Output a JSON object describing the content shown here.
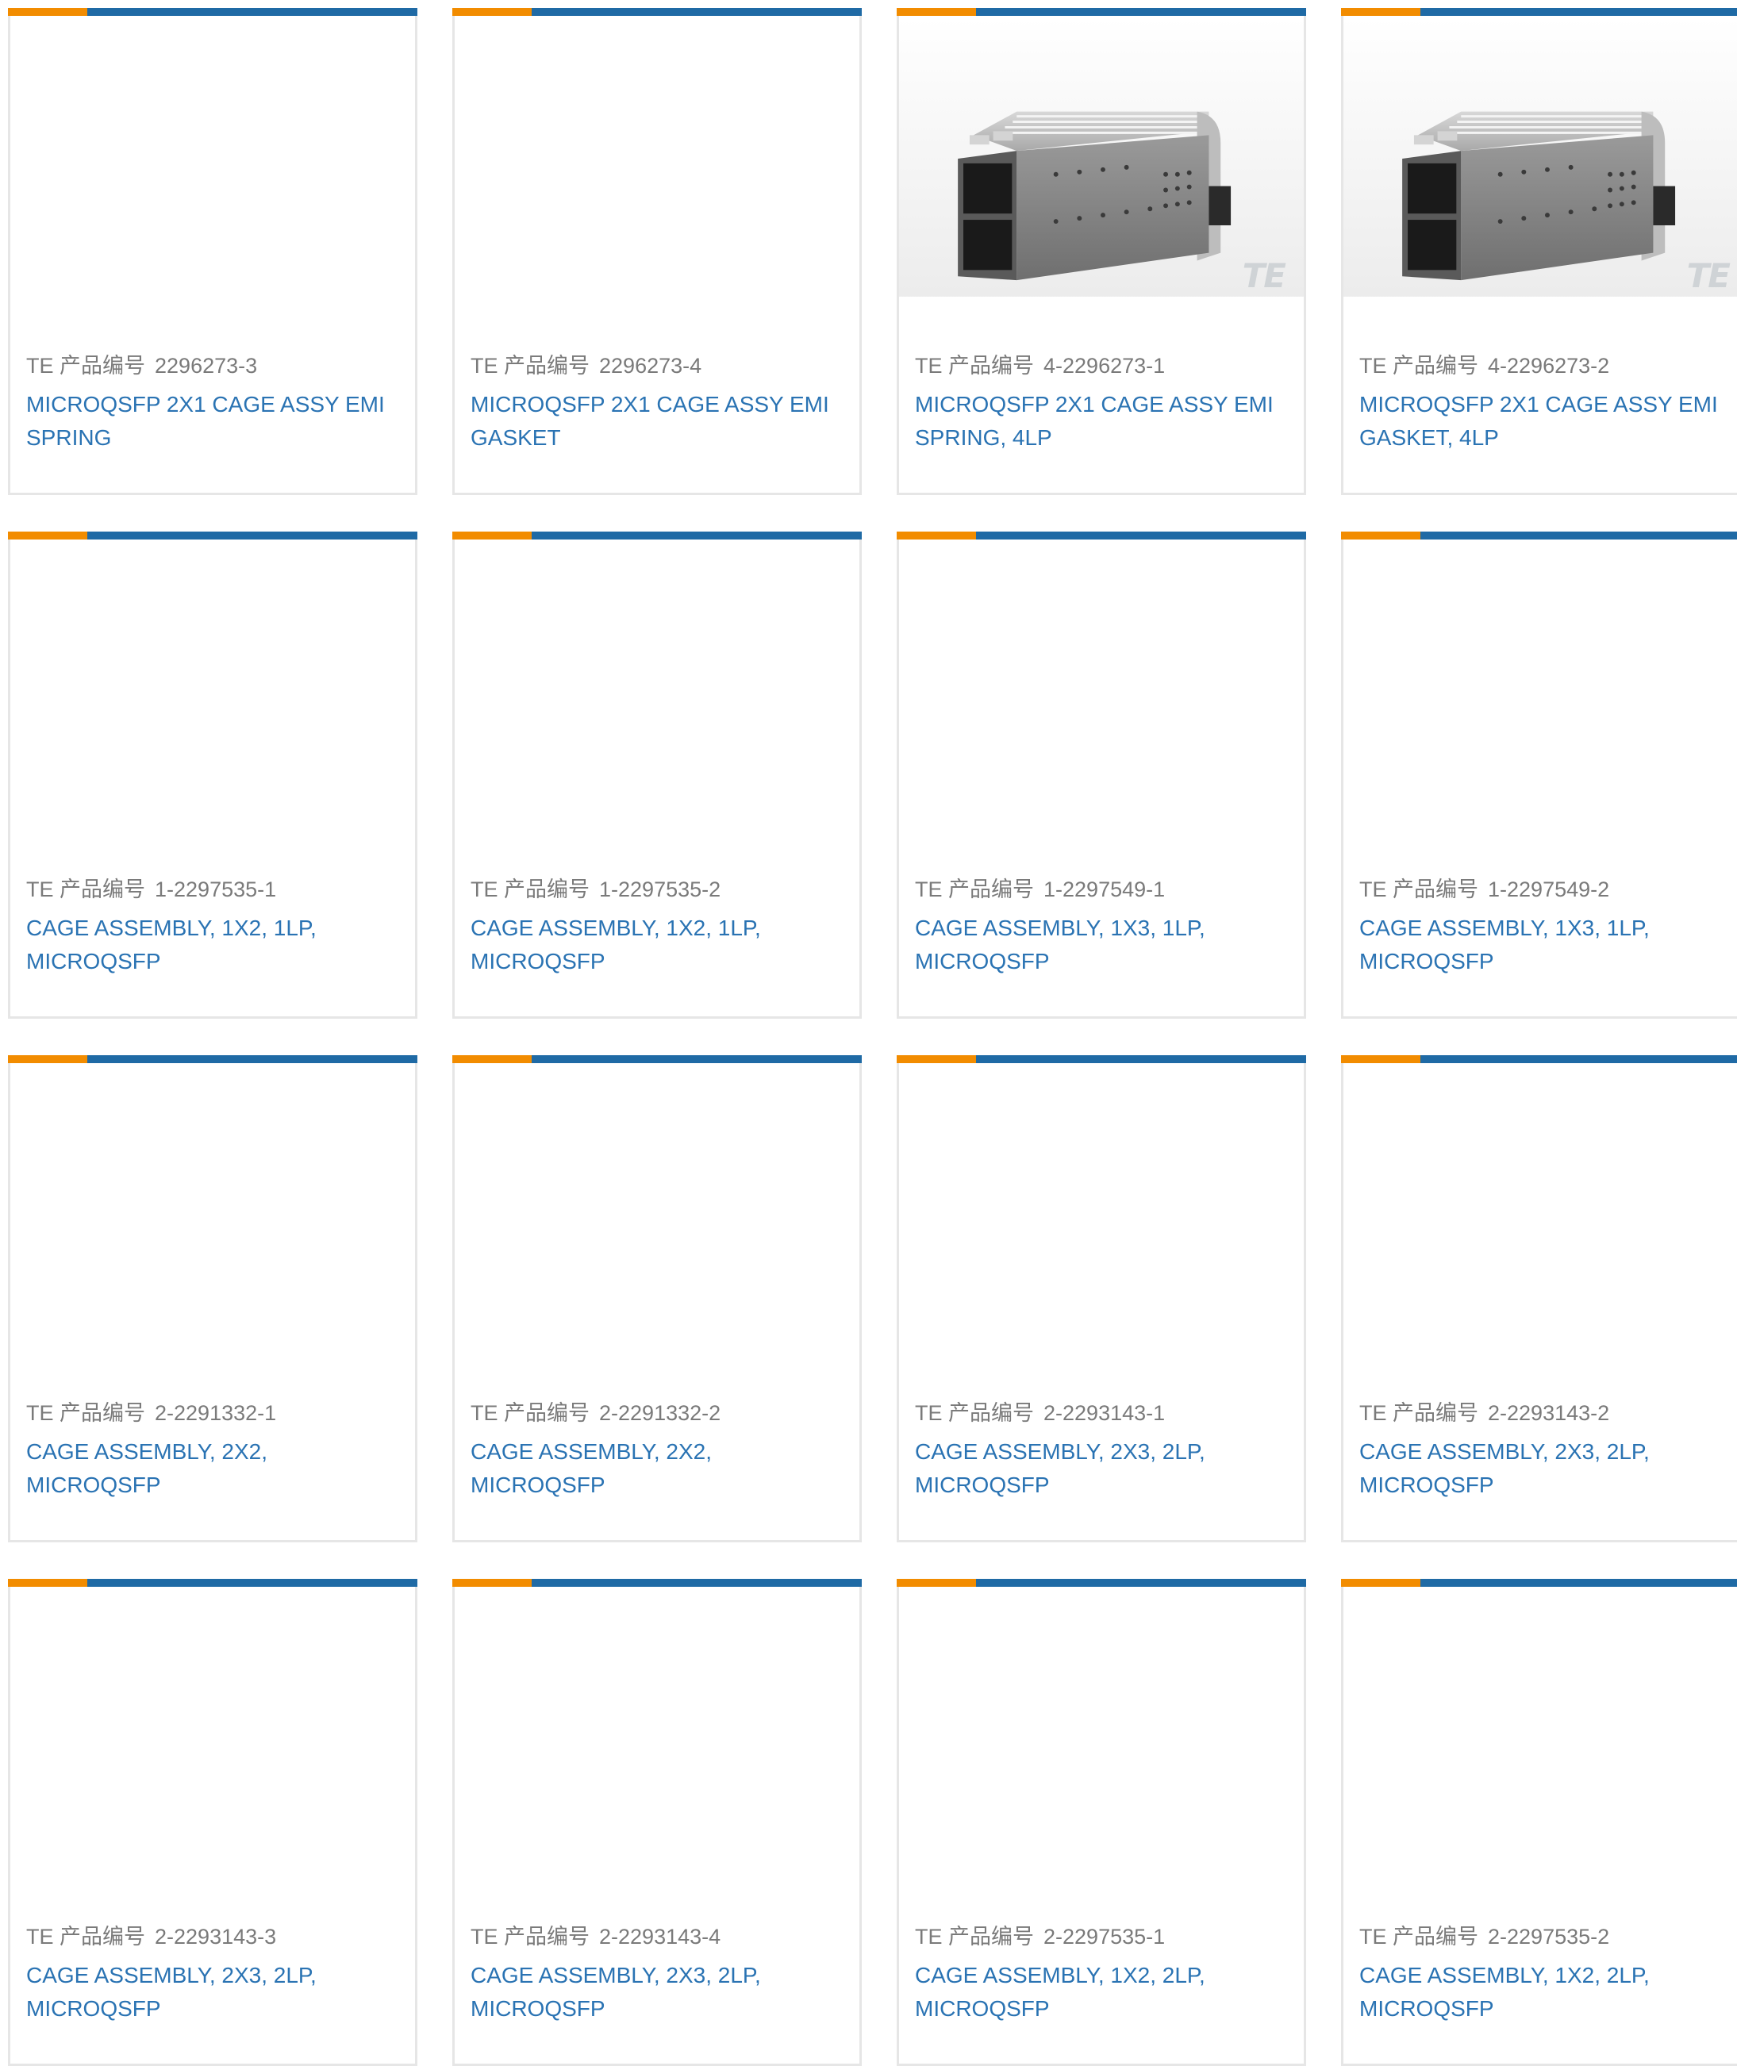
{
  "colors": {
    "accent_orange": "#f28c00",
    "accent_blue": "#1f6aa5",
    "link_blue": "#2a73b3",
    "label_gray": "#7a7a7a",
    "border_gray": "#e6e6e6"
  },
  "labels": {
    "part_number_prefix": "TE 产品编号"
  },
  "products": [
    {
      "part_number": "2296273-3",
      "description": "MICROQSFP 2X1 CAGE ASSY EMI SPRING",
      "has_image": false
    },
    {
      "part_number": "2296273-4",
      "description": "MICROQSFP 2X1 CAGE ASSY EMI GASKET",
      "has_image": false
    },
    {
      "part_number": "4-2296273-1",
      "description": "MICROQSFP 2X1 CAGE ASSY EMI SPRING, 4LP",
      "has_image": true,
      "image_logo": "TE"
    },
    {
      "part_number": "4-2296273-2",
      "description": "MICROQSFP 2X1 CAGE ASSY EMI GASKET, 4LP",
      "has_image": true,
      "image_logo": "TE"
    },
    {
      "part_number": "1-2297535-1",
      "description": "CAGE ASSEMBLY, 1X2, 1LP, MICROQSFP",
      "has_image": false
    },
    {
      "part_number": "1-2297535-2",
      "description": "CAGE ASSEMBLY, 1X2, 1LP, MICROQSFP",
      "has_image": false
    },
    {
      "part_number": "1-2297549-1",
      "description": "CAGE ASSEMBLY, 1X3, 1LP, MICROQSFP",
      "has_image": false
    },
    {
      "part_number": "1-2297549-2",
      "description": "CAGE ASSEMBLY, 1X3, 1LP, MICROQSFP",
      "has_image": false
    },
    {
      "part_number": "2-2291332-1",
      "description": "CAGE ASSEMBLY, 2X2, MICROQSFP",
      "has_image": false
    },
    {
      "part_number": "2-2291332-2",
      "description": "CAGE ASSEMBLY, 2X2, MICROQSFP",
      "has_image": false
    },
    {
      "part_number": "2-2293143-1",
      "description": "CAGE ASSEMBLY, 2X3, 2LP, MICROQSFP",
      "has_image": false
    },
    {
      "part_number": "2-2293143-2",
      "description": "CAGE ASSEMBLY, 2X3, 2LP, MICROQSFP",
      "has_image": false
    },
    {
      "part_number": "2-2293143-3",
      "description": "CAGE ASSEMBLY, 2X3, 2LP, MICROQSFP",
      "has_image": false
    },
    {
      "part_number": "2-2293143-4",
      "description": "CAGE ASSEMBLY, 2X3, 2LP, MICROQSFP",
      "has_image": false
    },
    {
      "part_number": "2-2297535-1",
      "description": "CAGE ASSEMBLY, 1X2, 2LP, MICROQSFP",
      "has_image": false
    },
    {
      "part_number": "2-2297535-2",
      "description": "CAGE ASSEMBLY, 1X2, 2LP, MICROQSFP",
      "has_image": false
    }
  ]
}
